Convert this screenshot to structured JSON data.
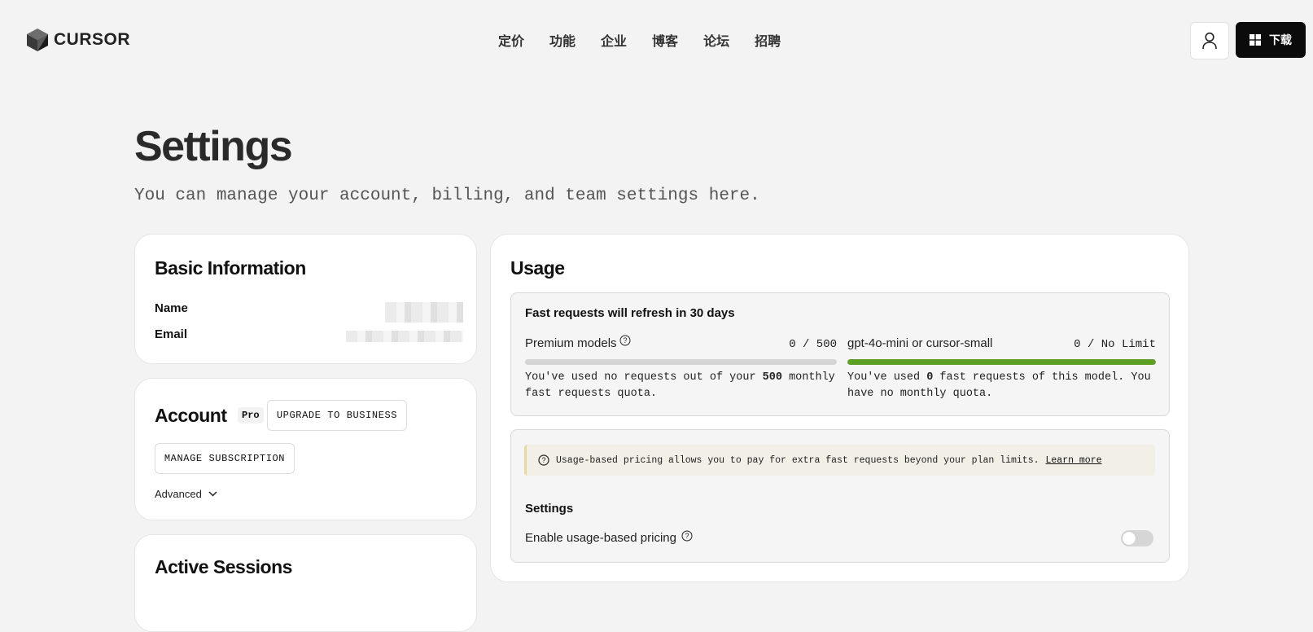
{
  "header": {
    "logo_text": "CURSOR",
    "nav": [
      "定价",
      "功能",
      "企业",
      "博客",
      "论坛",
      "招聘"
    ],
    "download_label": "下载"
  },
  "page": {
    "title": "Settings",
    "subtitle": "You can manage your account, billing, and team settings here."
  },
  "basic_info": {
    "title": "Basic Information",
    "name_label": "Name",
    "email_label": "Email"
  },
  "account": {
    "title": "Account",
    "plan_badge": "Pro",
    "upgrade_label": "UPGRADE TO BUSINESS",
    "manage_label": "MANAGE SUBSCRIPTION",
    "advanced_label": "Advanced"
  },
  "sessions": {
    "title": "Active Sessions"
  },
  "usage": {
    "title": "Usage",
    "refresh_text": "Fast requests will refresh in 30 days",
    "premium": {
      "label": "Premium models",
      "value": "0 / 500",
      "fill_fraction": 0,
      "desc_prefix": "You've used no requests out of your ",
      "desc_bold": "500",
      "desc_suffix": " monthly fast requests quota."
    },
    "small": {
      "label": "gpt-4o-mini or cursor-small",
      "value": "0 / No Limit",
      "fill_fraction": 1,
      "desc_prefix": "You've used ",
      "desc_bold": "0",
      "desc_suffix": " fast requests of this model. You have no monthly quota."
    },
    "notice_text": "Usage-based pricing allows you to pay for extra fast requests beyond your plan limits.",
    "notice_link": "Learn more",
    "settings_title": "Settings",
    "toggle_label": "Enable usage-based pricing",
    "toggle_on": false
  },
  "colors": {
    "accent_green": "#5e9f25",
    "track_gray": "#d4d4d4",
    "button_black": "#0b0b0b"
  }
}
